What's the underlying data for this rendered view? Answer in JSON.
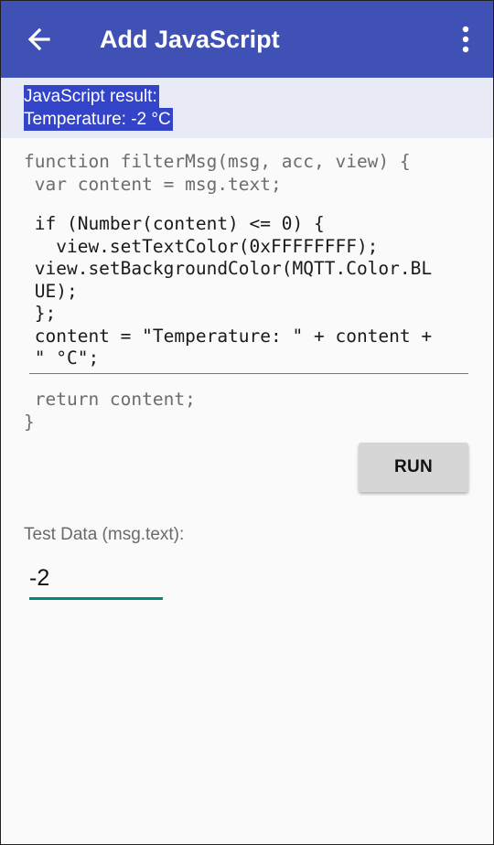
{
  "appbar": {
    "title": "Add JavaScript",
    "back_icon": "arrow-back-icon",
    "menu_icon": "more-vert-icon",
    "color": "#3f51b5"
  },
  "result": {
    "line1": "JavaScript result:",
    "line2": "Temperature: -2 °C",
    "highlight_color": "#3344c8"
  },
  "code": {
    "header": "function filterMsg(msg, acc, view) {\n var content = msg.text;",
    "body": " if (Number(content) <= 0) {\n   view.setTextColor(0xFFFFFFFF);\n view.setBackgroundColor(MQTT.Color.BL\n UE);\n };\n content = \"Temperature: \" + content +\n \" °C\";",
    "footer": " return content;\n}"
  },
  "run_button": {
    "label": "RUN"
  },
  "test_data": {
    "label": "Test Data (msg.text):",
    "value": "-2",
    "accent": "#00897b"
  }
}
